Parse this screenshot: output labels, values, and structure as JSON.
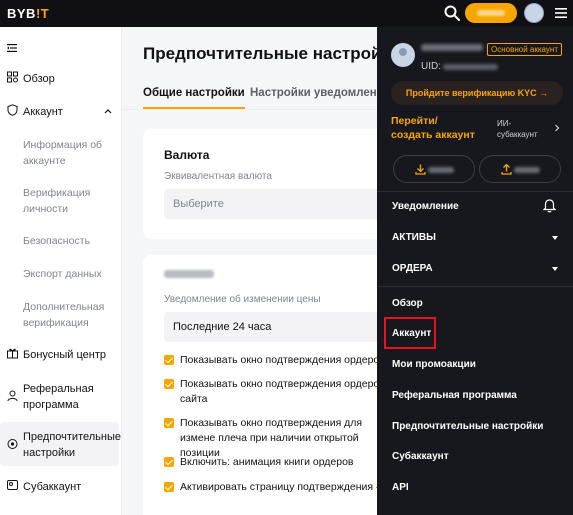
{
  "topbar": {
    "logo_main": "BYB",
    "logo_accent": "!T",
    "colors": {
      "background": "#101014",
      "accent": "#f7a600"
    },
    "icons": [
      "search-icon",
      "avatar",
      "menu-icon"
    ]
  },
  "sidebar": {
    "items": [
      {
        "label": "Обзор",
        "icon": "overview-icon"
      },
      {
        "label": "Аккаунт",
        "icon": "shield-icon",
        "expanded": true
      },
      {
        "label": "Бонусный центр",
        "icon": "gift-icon"
      },
      {
        "label": "Реферальная программа",
        "icon": "referral-icon"
      },
      {
        "label": "Предпочтительные настройки",
        "icon": "settings-icon",
        "active": true
      },
      {
        "label": "Субаккаунт",
        "icon": "subaccount-icon"
      }
    ],
    "subitems": [
      "Информация об аккаунте",
      "Верификация личности",
      "Безопасность",
      "Экспорт данных",
      "Дополнительная верификация"
    ]
  },
  "main": {
    "title": "Предпочтительные настройки",
    "tabs": [
      {
        "label": "Общие настройки",
        "active": true
      },
      {
        "label": "Настройки уведомлений",
        "active": false
      }
    ],
    "currency_card": {
      "title": "Валюта",
      "subtitle": "Эквивалентная валюта",
      "select_placeholder": "Выберите"
    },
    "notify_card": {
      "subtitle": "Уведомление об изменении цены",
      "select_value": "Последние 24 часа",
      "checkboxes": [
        {
          "label": "Показывать окно подтверждения ордеров",
          "checked": true
        },
        {
          "label": "Показывать окно подтверждения ордеров в сайта",
          "checked": true
        },
        {
          "label": "Показывать окно подтверждения для измене плеча при наличии открытой позиции",
          "checked": true
        },
        {
          "label": "Включить: анимация книги ордеров",
          "checked": true
        },
        {
          "label": "Активировать страницу подтверждения «От",
          "checked": true
        }
      ]
    }
  },
  "panel": {
    "badge": "Основной аккаунт",
    "uid_label": "UID:",
    "kyc_button": "Пройдите верификацию KYC →",
    "switch_link": "Перейти/создать аккаунт",
    "subaccount_label": "ИИ-субаккаунт",
    "menu": [
      {
        "label": "Уведомление",
        "icon": "bell-icon"
      },
      {
        "label": "АКТИВЫ",
        "caret": true
      },
      {
        "label": "ОРДЕРА",
        "caret": true
      },
      {
        "label": "Обзор"
      },
      {
        "label": "Аккаунт",
        "highlighted": true
      },
      {
        "label": "Мои промоакции"
      },
      {
        "label": "Реферальная программа"
      },
      {
        "label": "Предпочтительные настройки"
      },
      {
        "label": "Субаккаунт"
      },
      {
        "label": "API"
      }
    ],
    "colors": {
      "background": "#17181e",
      "highlight": "#e8131d",
      "accent": "#f7a600"
    }
  }
}
